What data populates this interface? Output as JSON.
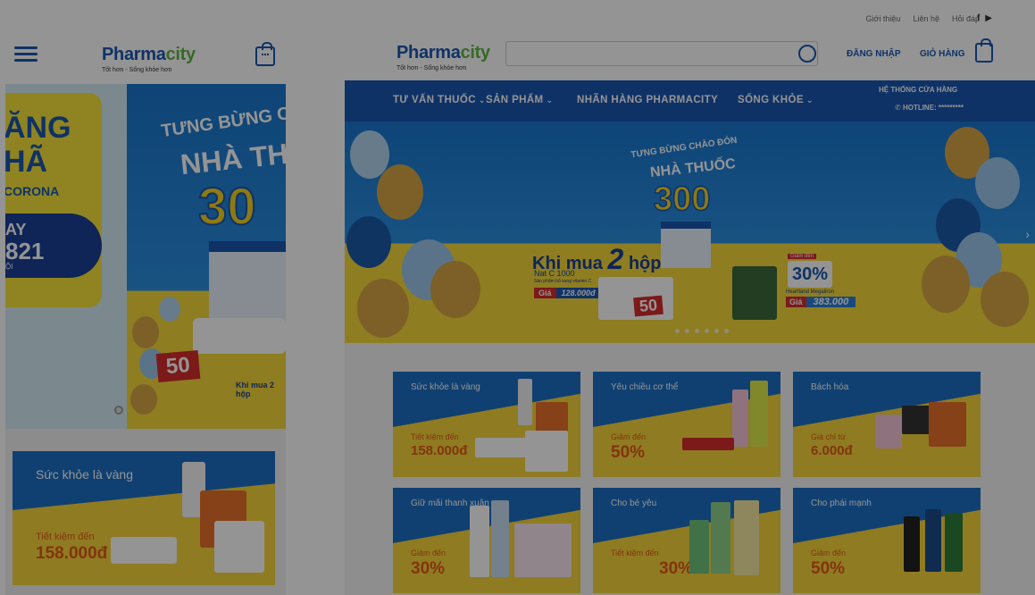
{
  "mobile": {
    "logo": {
      "brand_a": "Pharma",
      "brand_b": "city",
      "tagline": "Tốt hơn - Sống khỏe hơn"
    },
    "banner_left": {
      "line1": "ĂNG",
      "line2": "HÃ",
      "line3": "CORONA",
      "line4": "AY",
      "line5": "821",
      "line6": "ỘI"
    },
    "banner_right": {
      "line1": "TƯNG BỪNG C",
      "line2": "NHÀ TH",
      "line3": "30",
      "line4": "Khi mua 2 hộp"
    },
    "discount_badge": "50",
    "promo": {
      "title": "Sức khỏe là vàng",
      "label": "Tiết kiệm đến",
      "value": "158.000đ"
    }
  },
  "desktop": {
    "top_links": [
      "Giới thiệu",
      "Liên hệ",
      "Hỏi đáp"
    ],
    "social": [
      "f",
      "▶"
    ],
    "logo": {
      "brand_a": "Pharma",
      "brand_b": "city",
      "tagline": "Tốt hơn - Sống khỏe hơn"
    },
    "search_placeholder": "",
    "login_label": "ĐĂNG NHẬP",
    "cart_label": "GIỎ HÀNG",
    "nav": [
      "TƯ VẤN THUỐC",
      "SẢN PHẨM",
      "NHÃN HÀNG PHARMACITY",
      "SỐNG KHỎE"
    ],
    "system_label": "HỆ THỐNG CỬA HÀNG",
    "hotline": "HOTLINE: *********",
    "banner": {
      "line1": "TƯNG BỪNG CHÀO ĐÓN",
      "line2": "NHÀ THUỐC",
      "line3": "300",
      "khi_mua": "Khi mua",
      "two": "2",
      "hop": "hộp",
      "product": "Nat C 1000",
      "product_sub": "Sản phẩm bổ sung vitamin C",
      "price_label": "Giá",
      "price_left": "128.000đ",
      "discount_left": "50",
      "tag_giam": "Giảm đến",
      "discount_right": "30%",
      "brand_right": "Heartland Megaliron",
      "price_right": "383.000"
    },
    "tiles": [
      {
        "title": "Sức khỏe là vàng",
        "label": "Tiết kiệm đến",
        "value": "158.000đ"
      },
      {
        "title": "Yêu chiều cơ thể",
        "label": "Giảm đến",
        "value": "50%"
      },
      {
        "title": "Bách hóa",
        "label": "Giá chỉ từ",
        "value": "6.000đ"
      },
      {
        "title": "Giữ mãi thanh xuân",
        "label": "Giảm đến",
        "value": "30%"
      },
      {
        "title": "Cho bé yêu",
        "label": "Tiết kiệm đến",
        "value": "30%"
      },
      {
        "title": "Cho phái mạnh",
        "label": "Giảm đến",
        "value": "50%"
      }
    ]
  },
  "colors": {
    "brand_blue": "#1a57b0",
    "brand_green": "#5fb544",
    "promo_yellow": "#f6d53b",
    "promo_orange": "#e05a18"
  }
}
